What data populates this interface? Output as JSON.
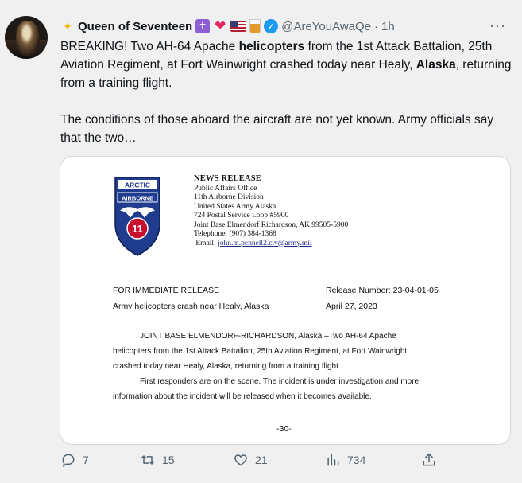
{
  "tweet": {
    "author_name": "Queen of Seventeen",
    "author_handle": "@AreYouAwaQe",
    "separator": "·",
    "time": "1h",
    "more": "···",
    "text_p1_a": "BREAKING! Two AH-64 Apache ",
    "text_p1_b": "helicopters",
    "text_p1_c": " from the 1st Attack Battalion, 25th Aviation Regiment, at Fort Wainwright crashed today near Healy, ",
    "text_p1_d": "Alaska",
    "text_p1_e": ", returning from a training flight.",
    "text_p2": "The conditions of those aboard the aircraft are not yet known. Army officials say that the two…"
  },
  "media": {
    "patch_top": "ARCTIC",
    "patch_tab": "AIRBORNE",
    "patch_number": "11",
    "release_title": "NEWS RELEASE",
    "release_lines": [
      "Public Affairs Office",
      "11th Airborne Division",
      "United States Army Alaska",
      "724 Postal Service Loop #5900",
      "Joint Base Elmendorf Richardson, AK 99505-5900",
      "Telephone: (907) 384-1368"
    ],
    "email_label": "Email:",
    "email": "john.m.pennell2.civ@army.mil",
    "immediate": "FOR IMMEDIATE RELEASE",
    "headline": "Army helicopters crash near Healy, Alaska",
    "release_number": "Release Number: 23-04-01-05",
    "release_date": "April 27, 2023",
    "body_l1": "JOINT BASE ELMENDORF-RICHARDSON, Alaska –Two AH-64 Apache",
    "body_l2": "helicopters from the 1st Attack Battalion, 25th Aviation Regiment, at Fort Wainwright",
    "body_l3": "crashed today near Healy, Alaska, returning from a training flight.",
    "body_l4": "First responders are on the scene. The incident is under investigation and more",
    "body_l5": "information about the incident will be released when it becomes available.",
    "end_mark": "-30-"
  },
  "actions": {
    "replies": "7",
    "retweets": "15",
    "likes": "21",
    "views": "734"
  },
  "colors": {
    "accent": "#1d9bf0",
    "secondary_text": "#536471",
    "background": "#f0f0f0"
  }
}
